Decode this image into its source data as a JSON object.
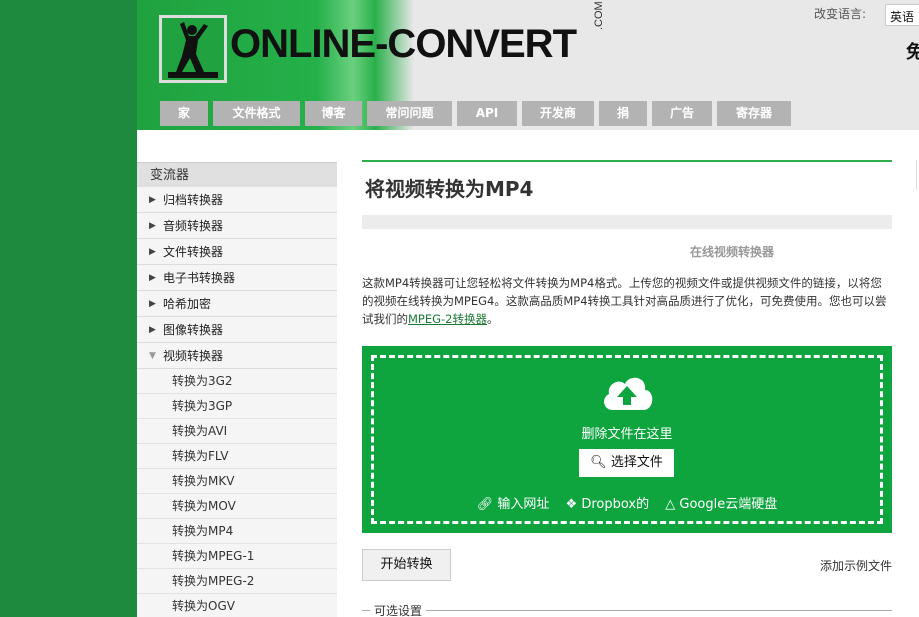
{
  "header": {
    "logo_text": "ONLINE-CONVERT",
    "logo_dotcom": ".COM",
    "lang_label": "改变语言:",
    "lang_value": "英语",
    "corner_char": "免"
  },
  "nav": [
    {
      "label": "家"
    },
    {
      "label": "文件格式"
    },
    {
      "label": "博客"
    },
    {
      "label": "常问问题"
    },
    {
      "label": "API"
    },
    {
      "label": "开发商"
    },
    {
      "label": "捐"
    },
    {
      "label": "广告"
    },
    {
      "label": "寄存器"
    }
  ],
  "sidebar": {
    "heading": "变流器",
    "items": [
      {
        "label": "归档转换器"
      },
      {
        "label": "音频转换器"
      },
      {
        "label": "文件转换器"
      },
      {
        "label": "电子书转换器"
      },
      {
        "label": "哈希加密"
      },
      {
        "label": "图像转换器"
      },
      {
        "label": "视频转换器"
      }
    ],
    "subitems": [
      {
        "label": "转换为3G2"
      },
      {
        "label": "转换为3GP"
      },
      {
        "label": "转换为AVI"
      },
      {
        "label": "转换为FLV"
      },
      {
        "label": "转换为MKV"
      },
      {
        "label": "转换为MOV"
      },
      {
        "label": "转换为MP4"
      },
      {
        "label": "转换为MPEG-1"
      },
      {
        "label": "转换为MPEG-2"
      },
      {
        "label": "转换为OGV"
      }
    ]
  },
  "main": {
    "title": "将视频转换为MP4",
    "subtitle": "在线视频转换器",
    "desc_text": "这款MP4转换器可让您轻松将文件转换为MP4格式。上传您的视频文件或提供视频文件的链接，以将您的视频在线转换为MPEG4。这款高品质MP4转换工具针对高品质进行了优化，可免费使用。您也可以尝试我们的",
    "desc_link": "MPEG-2转换器",
    "desc_end": "。",
    "drop_text": "删除文件在这里",
    "choose_label": "选择文件",
    "link_url": "输入网址",
    "link_dropbox": "Dropbox的",
    "link_gdrive": "Google云端硬盘",
    "start_label": "开始转换",
    "sample_label": "添加示例文件",
    "options_label": "可选设置"
  },
  "colors": {
    "brand_green": "#0ea53f",
    "nav_gray": "#b3b3b3"
  }
}
